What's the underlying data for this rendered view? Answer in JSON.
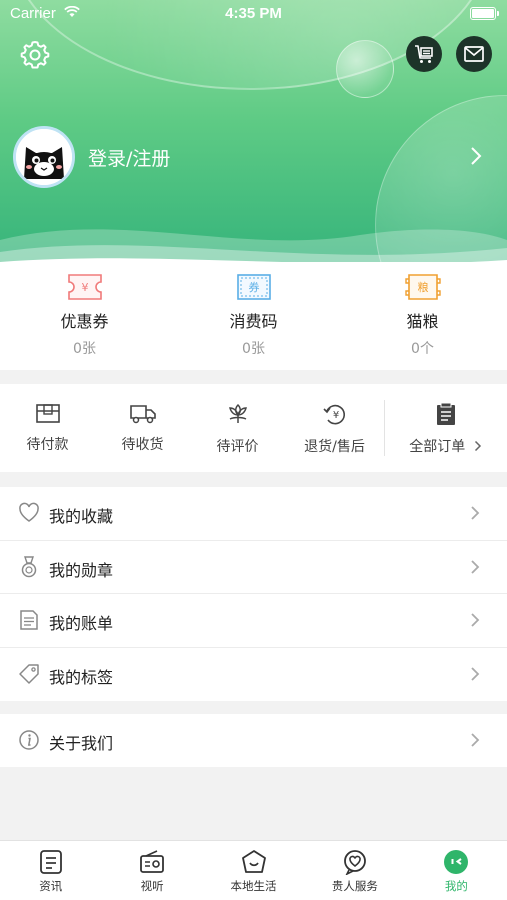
{
  "status_bar": {
    "carrier": "Carrier",
    "time": "4:35 PM"
  },
  "header": {
    "login_label": "登录/注册"
  },
  "assets": [
    {
      "icon": "coupon-icon",
      "icon_text": "¥",
      "label": "优惠券",
      "value": "0张",
      "color": "#f07a7a"
    },
    {
      "icon": "voucher-icon",
      "icon_text": "券",
      "label": "消费码",
      "value": "0张",
      "color": "#5aaee6"
    },
    {
      "icon": "cat-food-icon",
      "icon_text": "粮",
      "label": "猫粮",
      "value": "0个",
      "color": "#f0a030"
    }
  ],
  "orders": [
    {
      "icon": "wallet-icon",
      "label": "待付款"
    },
    {
      "icon": "truck-icon",
      "label": "待收货"
    },
    {
      "icon": "flower-icon",
      "label": "待评价"
    },
    {
      "icon": "refund-icon",
      "label": "退货/售后"
    },
    {
      "icon": "clipboard-icon",
      "label": "全部订单"
    }
  ],
  "menu": [
    {
      "icon": "heart-icon",
      "label": "我的收藏"
    },
    {
      "icon": "medal-icon",
      "label": "我的勋章"
    },
    {
      "icon": "bill-icon",
      "label": "我的账单"
    },
    {
      "icon": "tag-icon",
      "label": "我的标签"
    }
  ],
  "about": {
    "icon": "info-icon",
    "label": "关于我们"
  },
  "tabbar": [
    {
      "icon": "news-icon",
      "label": "资讯",
      "active": false
    },
    {
      "icon": "radio-icon",
      "label": "视听",
      "active": false
    },
    {
      "icon": "home-icon",
      "label": "本地生活",
      "active": false
    },
    {
      "icon": "service-icon",
      "label": "贵人服务",
      "active": false
    },
    {
      "icon": "profile-icon",
      "label": "我的",
      "active": true
    }
  ],
  "colors": {
    "accent": "#2fb56a",
    "header_top": "#8fdca0",
    "header_bottom": "#36b47b"
  }
}
